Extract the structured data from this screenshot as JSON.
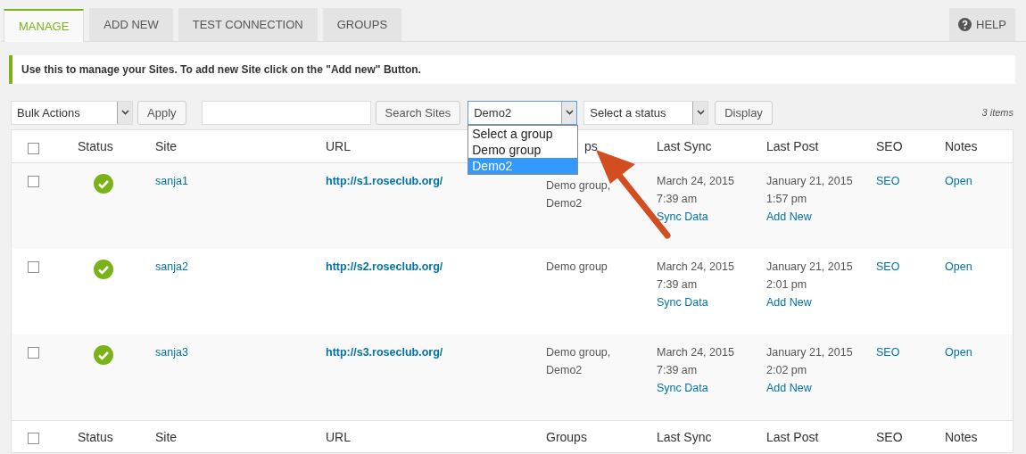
{
  "tabs": [
    {
      "label": "MANAGE",
      "selected": true
    },
    {
      "label": "ADD NEW",
      "selected": false
    },
    {
      "label": "TEST CONNECTION",
      "selected": false
    },
    {
      "label": "GROUPS",
      "selected": false
    }
  ],
  "help_button": {
    "label": "HELP"
  },
  "notice": "Use this to manage your Sites. To add new Site click on the \"Add new\" Button.",
  "toolbar": {
    "bulk_actions": {
      "value": "Bulk Actions"
    },
    "apply_button": "Apply",
    "search_button": "Search Sites",
    "group_select": {
      "value": "Demo2",
      "expanded": true,
      "options": [
        {
          "label": "Select a group",
          "selected": false
        },
        {
          "label": "Demo group",
          "selected": false
        },
        {
          "label": "Demo2",
          "selected": true
        }
      ]
    },
    "status_select": {
      "value": "Select a status"
    },
    "display_button": "Display",
    "count": "3 items"
  },
  "table": {
    "header_checked": false,
    "footer_checked": false,
    "header": [
      "Status",
      "Site",
      "URL",
      "ps",
      "Last Sync",
      "Last Post",
      "SEO",
      "Notes"
    ],
    "footer": [
      "Status",
      "Site",
      "URL",
      "Groups",
      "Last Sync",
      "Last Post",
      "SEO",
      "Notes"
    ],
    "rows": [
      {
        "checked": false,
        "status_ok": true,
        "site": "sanja1",
        "url": "http://s1.roseclub.org/",
        "groups": [
          "Demo group,",
          "Demo2"
        ],
        "last_sync": [
          "March 24, 2015",
          "7:39 am"
        ],
        "sync_link": "Sync Data",
        "last_post": [
          "January 21, 2015",
          "1:57 pm"
        ],
        "post_link": "Add New",
        "seo": "SEO",
        "notes": "Open"
      },
      {
        "checked": false,
        "status_ok": true,
        "site": "sanja2",
        "url": "http://s2.roseclub.org/",
        "groups": [
          "Demo group"
        ],
        "last_sync": [
          "March 24, 2015",
          "7:39 am"
        ],
        "sync_link": "Sync Data",
        "last_post": [
          "January 21, 2015",
          "2:01 pm"
        ],
        "post_link": "Add New",
        "seo": "SEO",
        "notes": "Open"
      },
      {
        "checked": false,
        "status_ok": true,
        "site": "sanja3",
        "url": "http://s3.roseclub.org/",
        "groups": [
          "Demo group,",
          "Demo2"
        ],
        "last_sync": [
          "March 24, 2015",
          "7:39 am"
        ],
        "sync_link": "Sync Data",
        "last_post": [
          "January 21, 2015",
          "2:02 pm"
        ],
        "post_link": "Add New",
        "seo": "SEO",
        "notes": "Open"
      }
    ]
  }
}
